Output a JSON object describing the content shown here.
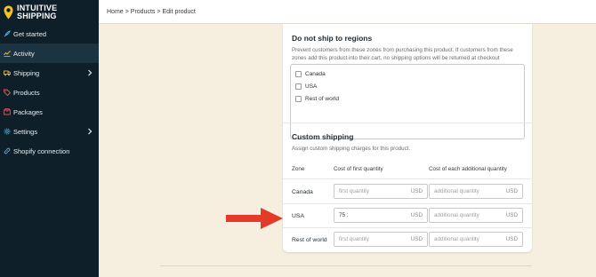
{
  "brand": {
    "line1": "INTUITIVE",
    "line2": "SHIPPING",
    "pin_color": "#f5c419"
  },
  "sidebar": {
    "items": [
      {
        "label": "Get started",
        "icon": "rocket-icon",
        "icon_color": "#4fb3d9"
      },
      {
        "label": "Activity",
        "icon": "activity-icon",
        "icon_color": "#e5b93d",
        "active": true
      },
      {
        "label": "Shipping",
        "icon": "truck-icon",
        "icon_color": "#e5b93d",
        "chevron": true
      },
      {
        "label": "Products",
        "icon": "tag-icon",
        "icon_color": "#e05d5d"
      },
      {
        "label": "Packages",
        "icon": "package-icon",
        "icon_color": "#e05d5d"
      },
      {
        "label": "Settings",
        "icon": "gear-icon",
        "icon_color": "#4fb3d9",
        "chevron": true
      },
      {
        "label": "Shopify connection",
        "icon": "link-icon",
        "icon_color": "#4fb3d9"
      }
    ]
  },
  "breadcrumb": {
    "home": "Home",
    "sep": ">",
    "products": "Products",
    "current": "Edit product"
  },
  "no_ship": {
    "title": "Do not ship to regions",
    "desc": "Prevent customers from these zones from purchasing this product. If customers from these zones add this product into their cart, no shipping options will be returned at checkout",
    "zones": [
      "Canada",
      "USA",
      "Rest of world"
    ]
  },
  "custom_shipping": {
    "title": "Custom shipping",
    "desc": "Assign custom shipping charges for this product.",
    "headers": {
      "zone": "Zone",
      "first": "Cost of first quantity",
      "additional": "Cost of each additional quantity"
    },
    "rows": [
      {
        "zone": "Canada",
        "first_value": "",
        "first_placeholder": "first quantity",
        "additional_value": "",
        "additional_placeholder": "additional quantity",
        "currency": "USD"
      },
      {
        "zone": "USA",
        "first_value": "75 :",
        "first_placeholder": "first quantity",
        "additional_value": "",
        "additional_placeholder": "additional quantity",
        "currency": "USD"
      },
      {
        "zone": "Rest of world",
        "first_value": "",
        "first_placeholder": "first quantity",
        "additional_value": "",
        "additional_placeholder": "additional quantity",
        "currency": "USD"
      }
    ]
  },
  "colors": {
    "sidebar_bg": "#0f1f2a",
    "page_bg": "#f6efe0",
    "arrow": "#e53a2a"
  }
}
